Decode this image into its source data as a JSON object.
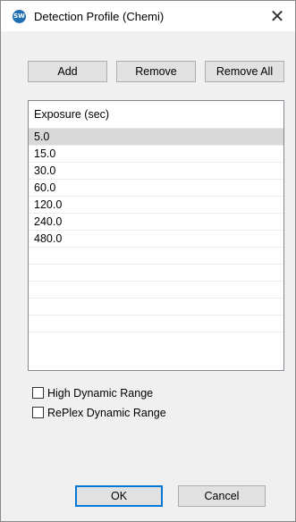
{
  "window": {
    "title": "Detection Profile (Chemi)",
    "app_icon_text": "SW",
    "close_symbol": "✕"
  },
  "toolbar": {
    "add_label": "Add",
    "remove_label": "Remove",
    "remove_all_label": "Remove All"
  },
  "exposure_list": {
    "header": "Exposure (sec)",
    "rows": [
      "5.0",
      "15.0",
      "30.0",
      "60.0",
      "120.0",
      "240.0",
      "480.0"
    ],
    "selected_index": 0
  },
  "options": {
    "high_dynamic_range_label": "High Dynamic Range",
    "high_dynamic_range_checked": false,
    "replex_dynamic_range_label": "RePlex Dynamic Range",
    "replex_dynamic_range_checked": false
  },
  "footer": {
    "ok_label": "OK",
    "cancel_label": "Cancel"
  },
  "colors": {
    "selection": "#d9d9d9",
    "default_button_border": "#0078d7",
    "icon_blue": "#1f6fb2"
  }
}
